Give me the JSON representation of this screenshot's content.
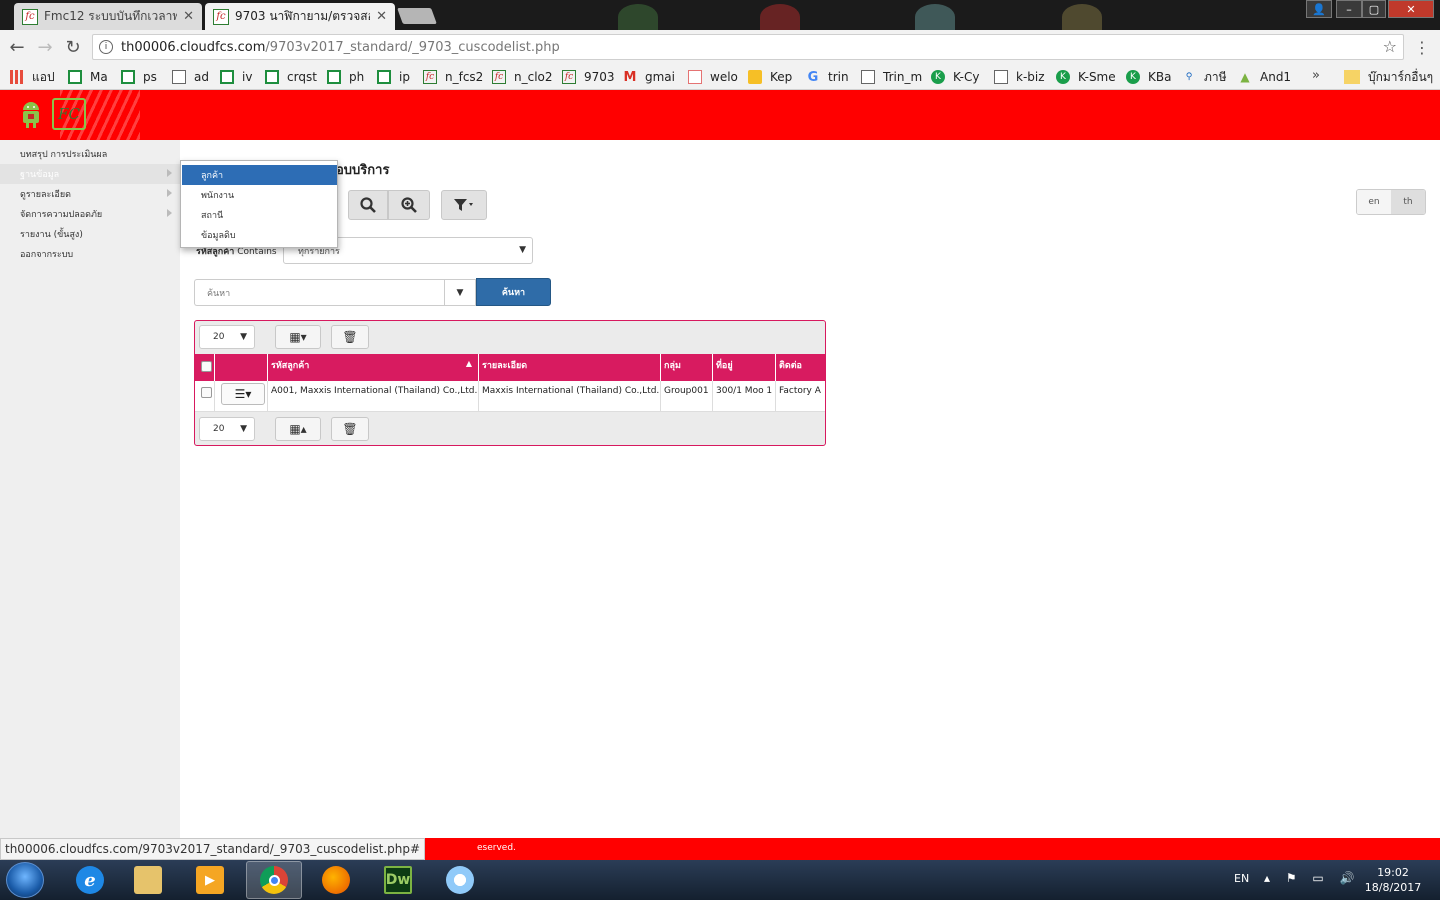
{
  "browser": {
    "tabs": [
      {
        "title": "Fmc12 ระบบบันทึกเวลาพนัก",
        "active": false
      },
      {
        "title": "9703 นาฬิกายาม/ตรวจสอบ",
        "active": true
      }
    ],
    "url_host": "th00006.cloudfcs.com",
    "url_path": "/9703v2017_standard/_9703_cuscodelist.php",
    "bookmarks": [
      {
        "label": "แอป",
        "icon": "apps-icon"
      },
      {
        "label": "Ma",
        "icon": "sheets-icon"
      },
      {
        "label": "ps",
        "icon": "sheets-icon"
      },
      {
        "label": "ad",
        "icon": "doc-icon"
      },
      {
        "label": "iv",
        "icon": "sheets-icon"
      },
      {
        "label": "crqst",
        "icon": "sheets-icon"
      },
      {
        "label": "ph",
        "icon": "sheets-icon"
      },
      {
        "label": "ip",
        "icon": "sheets-icon"
      },
      {
        "label": "n_fcs2",
        "icon": "fc-icon"
      },
      {
        "label": "n_clo2",
        "icon": "fc-icon"
      },
      {
        "label": "9703",
        "icon": "fc-icon"
      },
      {
        "label": "gmai",
        "icon": "gmail-icon"
      },
      {
        "label": "welo",
        "icon": "bag-icon"
      },
      {
        "label": "Kep",
        "icon": "keep-icon"
      },
      {
        "label": "trin",
        "icon": "google-icon"
      },
      {
        "label": "Trin_m",
        "icon": "doc-icon"
      },
      {
        "label": "K-Cy",
        "icon": "kbank-icon"
      },
      {
        "label": "k-biz",
        "icon": "doc-icon"
      },
      {
        "label": "K-Sme",
        "icon": "kbank-icon"
      },
      {
        "label": "KBa",
        "icon": "kbank-icon"
      },
      {
        "label": "ภาษี",
        "icon": "link-icon"
      },
      {
        "label": "And1",
        "icon": "android-icon"
      }
    ],
    "bookmarks_more": "»",
    "other_bookmarks": "บุ๊กมาร์กอื่นๆ",
    "status_url": "th00006.cloudfcs.com/9703v2017_standard/_9703_cuscodelist.php#"
  },
  "app": {
    "logo_text": "FC",
    "sidebar": [
      {
        "label": "บทสรุป การประเมินผล",
        "has_sub": false,
        "active": false
      },
      {
        "label": "ฐานข้อมูล",
        "has_sub": true,
        "active": true
      },
      {
        "label": "ดูรายละเอียด",
        "has_sub": true,
        "active": false
      },
      {
        "label": "จัดการความปลอดภัย",
        "has_sub": true,
        "active": false
      },
      {
        "label": "รายงาน (ขั้นสูง)",
        "has_sub": false,
        "active": false
      },
      {
        "label": "ออกจากระบบ",
        "has_sub": false,
        "active": false
      }
    ],
    "dropdown": [
      {
        "label": "ลูกค้า",
        "active": true
      },
      {
        "label": "พนักงาน",
        "active": false
      },
      {
        "label": "สถานี",
        "active": false
      },
      {
        "label": "ข้อมูลดิบ",
        "active": false
      }
    ],
    "page_title": "อบบริการ",
    "language": {
      "en": "en",
      "th": "th",
      "selected": "th"
    },
    "filter": {
      "field": "รหัสลูกค้า",
      "operator": "Contains",
      "value": "ทุกรายการ"
    },
    "search": {
      "placeholder": "ค้นหา",
      "button": "ค้นหา"
    },
    "grid": {
      "page_size": "20",
      "columns": [
        "รหัสลูกค้า",
        "รายละเอียด",
        "กลุ่ม",
        "ที่อยู่",
        "ติดต่อ"
      ],
      "sort_column": "รหัสลูกค้า",
      "rows": [
        {
          "code": "A001, Maxxis International (Thailand) Co.,Ltd.",
          "detail": "Maxxis International (Thailand) Co.,Ltd.",
          "group": "Group001",
          "address": "300/1 Moo 1",
          "contact": "Factory A"
        }
      ]
    },
    "footer_text": "eserved."
  },
  "taskbar": {
    "apps": [
      {
        "name": "ie-icon",
        "active": false
      },
      {
        "name": "explorer-icon",
        "active": false
      },
      {
        "name": "media-icon",
        "active": false
      },
      {
        "name": "chrome-icon",
        "active": true
      },
      {
        "name": "firefox-icon",
        "active": false
      },
      {
        "name": "dreamweaver-icon",
        "label": "Dw",
        "active": false
      },
      {
        "name": "paint-icon",
        "active": false
      }
    ],
    "lang": "EN",
    "time": "19:02",
    "date": "18/8/2017"
  }
}
